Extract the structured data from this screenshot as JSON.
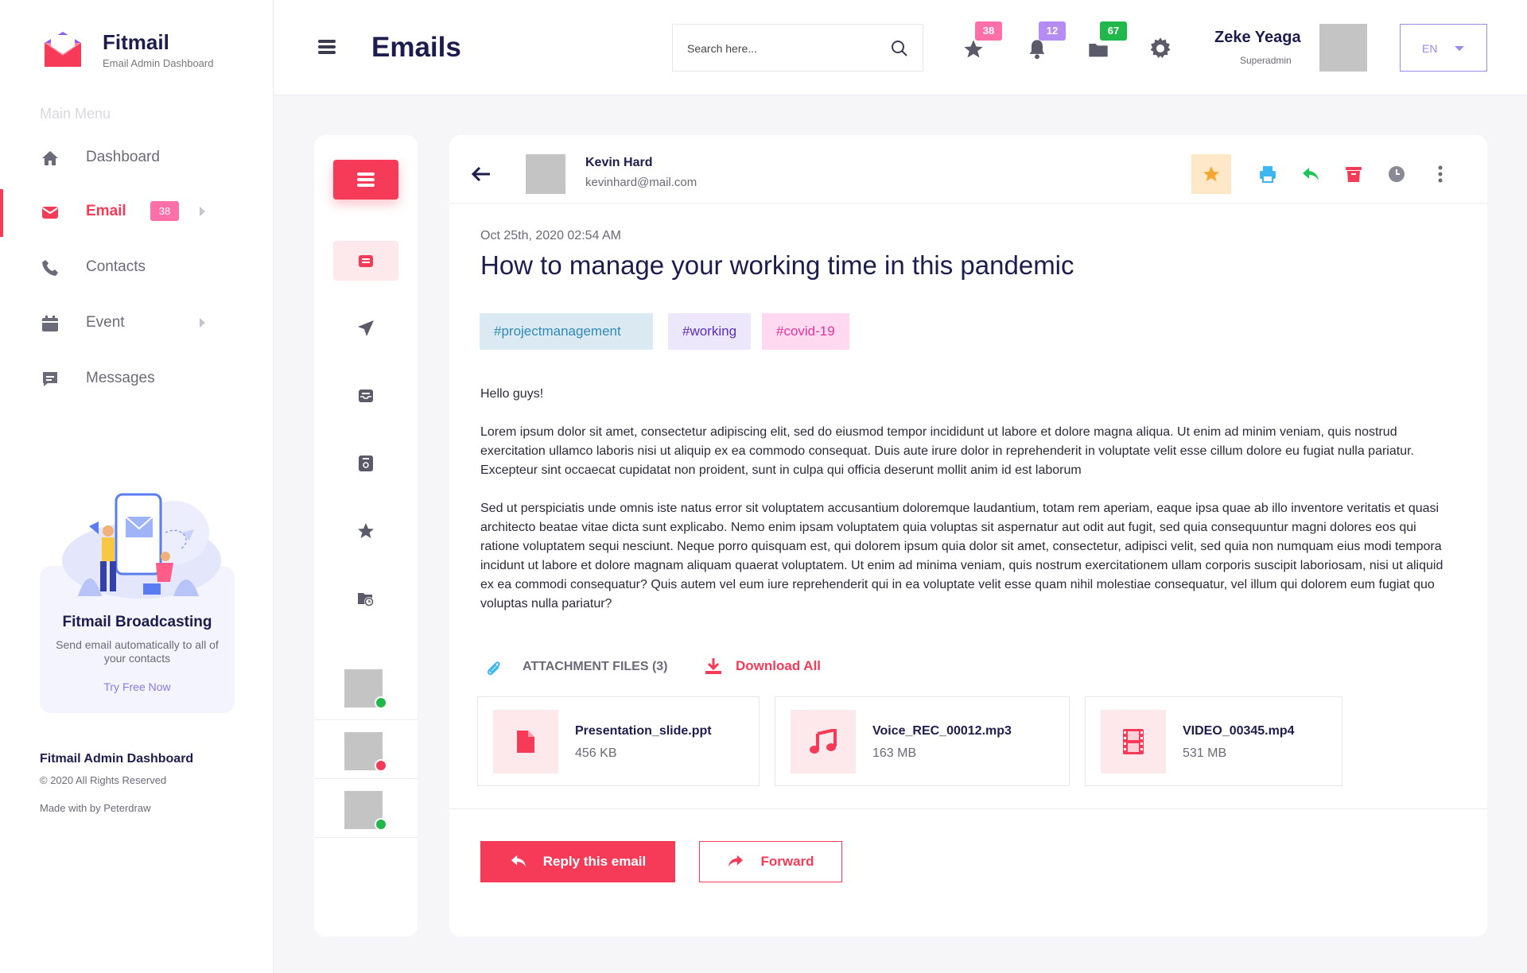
{
  "brand": {
    "name": "Fitmail",
    "subtitle": "Email Admin Dashboard"
  },
  "sidebar": {
    "section_title": "Main Menu",
    "items": [
      {
        "label": "Dashboard",
        "icon": "home-icon"
      },
      {
        "label": "Email",
        "icon": "email-icon",
        "badge": "38",
        "active": true
      },
      {
        "label": "Contacts",
        "icon": "phone-icon"
      },
      {
        "label": "Event",
        "icon": "calendar-icon"
      },
      {
        "label": "Messages",
        "icon": "chat-icon"
      }
    ],
    "promo": {
      "title": "Fitmail Broadcasting",
      "text": "Send email automatically to all of your contacts",
      "link": "Try Free Now"
    },
    "footer": {
      "title": "Fitmail Admin Dashboard",
      "copyright": "© 2020 All Rights Reserved",
      "made_with": "Made with  by Peterdraw"
    }
  },
  "header": {
    "title": "Emails",
    "search_placeholder": "Search here...",
    "badges": {
      "favorites": "38",
      "notifications": "12",
      "archive": "67"
    },
    "user": {
      "name": "Zeke Yeaga",
      "role": "Superadmin"
    },
    "language": "EN"
  },
  "email": {
    "sender_name": "Kevin Hard",
    "sender_email": "kevinhard@mail.com",
    "date": "Oct 25th, 2020  02:54 AM",
    "subject": "How to manage your working time in this pandemic",
    "tags": [
      "#projectmanagement",
      "#working",
      "#covid-19"
    ],
    "greeting": "Hello guys!",
    "paragraphs": [
      "Lorem ipsum dolor sit amet, consectetur adipiscing elit, sed do eiusmod tempor incididunt ut labore et dolore magna aliqua. Ut enim ad minim veniam, quis nostrud exercitation ullamco laboris nisi ut aliquip ex ea commodo consequat. Duis aute irure dolor in reprehenderit in voluptate velit esse cillum dolore eu fugiat nulla pariatur. Excepteur sint occaecat cupidatat non proident, sunt in culpa qui officia deserunt mollit anim id est laborum",
      "Sed ut perspiciatis unde omnis iste natus error sit voluptatem accusantium doloremque laudantium, totam rem aperiam, eaque ipsa quae ab illo inventore veritatis et quasi architecto beatae vitae dicta sunt explicabo. Nemo enim ipsam voluptatem quia voluptas sit aspernatur aut odit aut fugit, sed quia consequuntur magni dolores eos qui ratione voluptatem sequi nesciunt. Neque porro quisquam est, qui dolorem ipsum quia dolor sit amet, consectetur, adipisci velit, sed quia non numquam eius modi tempora incidunt ut labore et dolore magnam aliquam quaerat voluptatem. Ut enim ad minima veniam, quis nostrum exercitationem ullam corporis suscipit laboriosam, nisi ut aliquid ex ea commodi consequatur? Quis autem vel eum iure reprehenderit qui in ea voluptate velit esse quam nihil molestiae consequatur, vel illum qui dolorem eum fugiat quo voluptas nulla pariatur?"
    ],
    "attachments_label": "ATTACHMENT FILES (3)",
    "download_all": "Download All",
    "attachments": [
      {
        "name": "Presentation_slide.ppt",
        "size": "456 KB",
        "icon": "document-icon"
      },
      {
        "name": "Voice_REC_00012.mp3",
        "size": "163 MB",
        "icon": "music-icon"
      },
      {
        "name": "VIDEO_00345.mp4",
        "size": "531 MB",
        "icon": "film-icon"
      }
    ],
    "reply_label": "Reply this email",
    "forward_label": "Forward"
  },
  "colors": {
    "accent": "#f53b57",
    "navy": "#1d1d4d",
    "purple": "#9b8ae8",
    "badge_pink": "#ff6fa8",
    "badge_purple": "#b58cf2",
    "badge_green": "#21b84b",
    "star_bg": "#ffe8c7",
    "star": "#f7a632"
  }
}
